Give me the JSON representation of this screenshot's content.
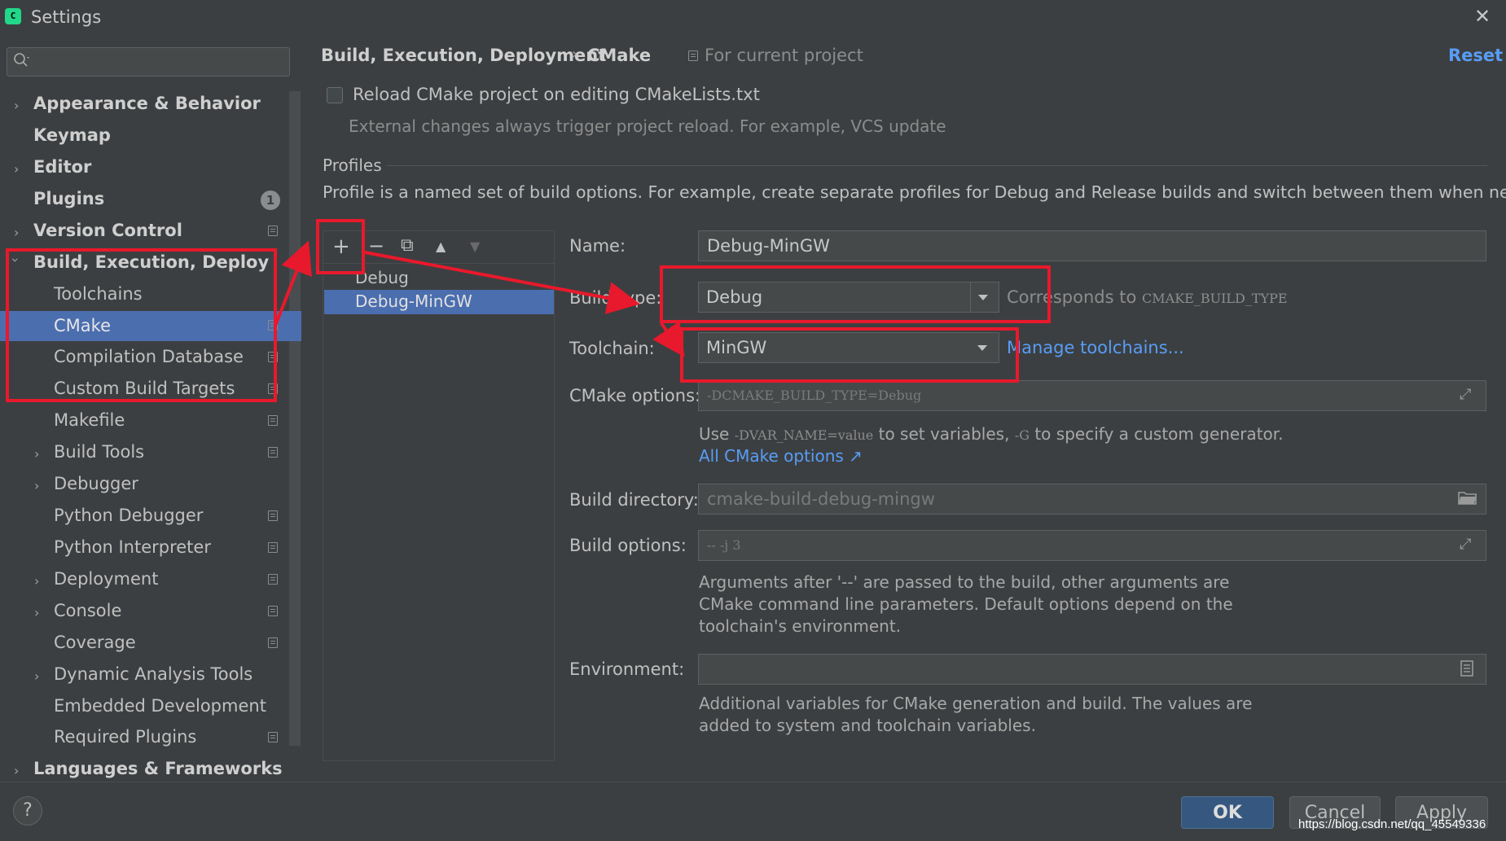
{
  "window": {
    "title": "Settings",
    "close_symbol": "✕"
  },
  "sidebar": {
    "search_placeholder": "",
    "items": [
      {
        "label": "Appearance & Behavior",
        "badge": ""
      },
      {
        "label": "Keymap"
      },
      {
        "label": "Editor"
      },
      {
        "label": "Plugins",
        "badge": "1"
      },
      {
        "label": "Version Control"
      },
      {
        "label": "Build, Execution, Deployment"
      },
      {
        "label": "Toolchains"
      },
      {
        "label": "CMake"
      },
      {
        "label": "Compilation Database"
      },
      {
        "label": "Custom Build Targets"
      },
      {
        "label": "Makefile"
      },
      {
        "label": "Build Tools"
      },
      {
        "label": "Debugger"
      },
      {
        "label": "Python Debugger"
      },
      {
        "label": "Python Interpreter"
      },
      {
        "label": "Deployment"
      },
      {
        "label": "Console"
      },
      {
        "label": "Coverage"
      },
      {
        "label": "Dynamic Analysis Tools"
      },
      {
        "label": "Embedded Development"
      },
      {
        "label": "Required Plugins"
      },
      {
        "label": "Languages & Frameworks"
      }
    ]
  },
  "header": {
    "breadcrumb_parent": "Build, Execution, Deployment",
    "breadcrumb_sep": "›",
    "breadcrumb_current": "CMake",
    "scope": "For current project",
    "reset": "Reset"
  },
  "reload": {
    "checked": false,
    "label": "Reload CMake project on editing CMakeLists.txt",
    "hint": "External changes always trigger project reload. For example, VCS update"
  },
  "profiles": {
    "title": "Profiles",
    "description": "Profile is a named set of build options. For example, create separate profiles for Debug and Release builds and switch between them when needed.",
    "toolbar": {
      "add": "+",
      "remove": "−",
      "copy": "⧉",
      "up": "▲",
      "down": "▼"
    },
    "list": [
      "Debug",
      "Debug-MinGW"
    ],
    "selected": "Debug-MinGW"
  },
  "form": {
    "name_label": "Name:",
    "name_value": "Debug-MinGW",
    "build_type_label": "Build type:",
    "build_type_value": "Debug",
    "build_type_hint_prefix": "Corresponds to",
    "build_type_hint_code": "CMAKE_BUILD_TYPE",
    "toolchain_label": "Toolchain:",
    "toolchain_value": "MinGW",
    "manage_toolchains": "Manage toolchains...",
    "cmake_options_label": "CMake options:",
    "cmake_options_placeholder": "-DCMAKE_BUILD_TYPE=Debug",
    "cmake_hint_1": "Use",
    "cmake_hint_code_1": "-DVAR_NAME=value",
    "cmake_hint_2": "to set variables,",
    "cmake_hint_code_2": "-G",
    "cmake_hint_3": "to specify a custom generator.",
    "all_cmake_options": "All CMake options ↗",
    "build_dir_label": "Build directory:",
    "build_dir_placeholder": "cmake-build-debug-mingw",
    "build_options_label": "Build options:",
    "build_options_placeholder": "-- -j 3",
    "build_options_hint_1": "Arguments after '--' are passed to the build, other arguments are",
    "build_options_hint_2": "CMake command line parameters. Default options depend on the",
    "build_options_hint_3": "toolchain's environment.",
    "environment_label": "Environment:",
    "environment_value": "",
    "environment_hint_1": "Additional variables for CMake generation and build. The values are",
    "environment_hint_2": "added to system and toolchain variables."
  },
  "footer": {
    "help": "?",
    "ok": "OK",
    "cancel": "Cancel",
    "apply": "Apply"
  },
  "watermark": "https://blog.csdn.net/qq_45549336",
  "colors": {
    "accent": "#4b6eaf",
    "link": "#589df6",
    "annotation": "#e8192c",
    "background": "#3c3f41"
  }
}
